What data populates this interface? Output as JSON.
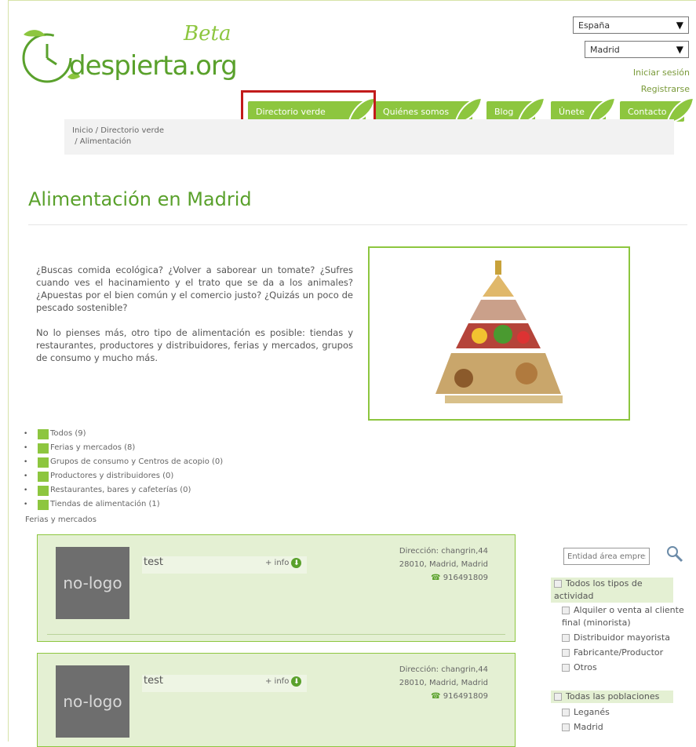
{
  "brand": {
    "beta": "Beta",
    "name": "despierta.org"
  },
  "selects": {
    "country": "España",
    "city": "Madrid"
  },
  "auth": {
    "login": "Iniciar sesión",
    "register": "Registrarse"
  },
  "nav": [
    "Directorio verde",
    "Quiénes somos",
    "Blog",
    "Únete",
    "Contacto"
  ],
  "breadcrumb": {
    "home": "Inicio",
    "sep": "/",
    "section": "Directorio verde",
    "current": "Alimentación"
  },
  "page": {
    "title": "Alimentación en Madrid"
  },
  "intro": {
    "p1": "¿Buscas comida ecológica? ¿Volver a saborear un tomate? ¿Sufres cuando ves el hacinamiento y el trato que se da a los animales? ¿Apuestas por el bien común y el comercio justo? ¿Quizás un poco de pescado sostenible?",
    "p2": "No lo pienses más, otro tipo de alimentación es posible: tiendas y restaurantes, productores y distribuidores, ferias y mercados, grupos de consumo y mucho más."
  },
  "categories": [
    "Todos (9)",
    "Ferias y mercados (8)",
    "Grupos de consumo y Centros de acopio (0)",
    "Productores y distribuidores (0)",
    "Restaurantes, bares y cafeterías (0)",
    "Tiendas de alimentación (1)"
  ],
  "section_label": "Ferias y mercados",
  "listings": [
    {
      "logo": "no-logo",
      "name": "test",
      "more": "+ info",
      "addr1": "Dirección: changrin,44",
      "addr2": "28010, Madrid, Madrid",
      "phone": "916491809"
    },
    {
      "logo": "no-logo",
      "name": "test",
      "more": "+ info",
      "addr1": "Dirección: changrin,44",
      "addr2": "28010, Madrid, Madrid",
      "phone": "916491809"
    }
  ],
  "filters": {
    "search_placeholder": "Entidad área empres",
    "activity_all": "Todos los tipos de actividad",
    "activity": [
      "Alquiler o venta al cliente final (minorista)",
      "Distribuidor mayorista",
      "Fabricante/Productor",
      "Otros"
    ],
    "places_all": "Todas las poblaciones",
    "places": [
      "Leganés",
      "Madrid"
    ]
  },
  "colors": {
    "brand_green": "#8dc63f",
    "dark_green": "#5aa12c",
    "highlight_red": "#c21b1b"
  }
}
